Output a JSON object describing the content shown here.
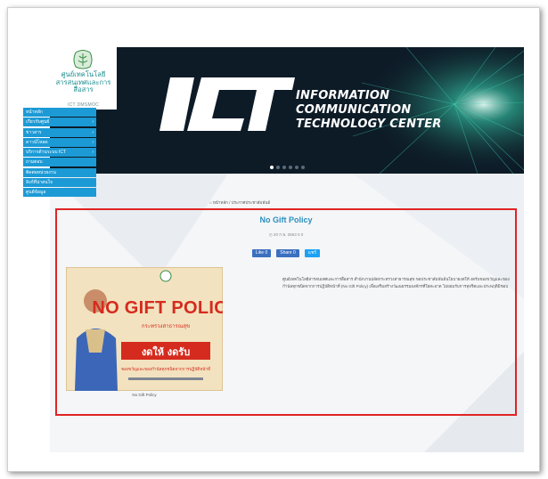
{
  "site": {
    "org_name_th": "ศูนย์เทคโนโลยีสารสนเทศและการสื่อสาร",
    "org_short": "ICT DMSMOC"
  },
  "banner": {
    "logo_text": "ICT",
    "line1": "INFORMATION",
    "line2": "COMMUNICATION",
    "line3": "TECHNOLOGY CENTER",
    "slides_total": 6,
    "slide_active": 1
  },
  "menu": {
    "items": [
      {
        "label": "หน้าหลัก",
        "has_caret": false
      },
      {
        "label": "เกี่ยวกับศูนย์",
        "has_caret": true
      },
      {
        "label": "ข่าวสาร",
        "has_caret": true
      },
      {
        "label": "ดาวน์โหลด",
        "has_caret": true
      },
      {
        "label": "บริการด้านระบบ ICT",
        "has_caret": true
      },
      {
        "label": "ถามตอบ",
        "has_caret": false
      },
      {
        "label": "ติดต่อหน่วยงาน",
        "has_caret": false
      },
      {
        "label": "ลิงก์ที่น่าสนใจ",
        "has_caret": false
      },
      {
        "label": "ศูนย์ข้อมูล",
        "has_caret": false
      }
    ]
  },
  "breadcrumb": {
    "text": "หน้าหลัก / ประกาศประชาสัมพันธ์"
  },
  "post": {
    "title": "No Gift Policy",
    "meta": "20 ก.พ. 2563   0   0",
    "share": {
      "like": "Like 0",
      "share": "Share 0",
      "tweet": "แชร์"
    },
    "image_caption": "No Gift Policy",
    "body": "ศูนย์เทคโนโลยีสารสนเทศและการสื่อสาร สำนักงานปลัดกระทรวงสาธารณสุข ขอประชาสัมพันธ์นโยบายงดให้ งดรับของขวัญและของกำนัลทุกชนิดจากการปฏิบัติหน้าที่ (No Gift Policy) เพื่อเสริมสร้างวัฒนธรรมองค์กรที่ใสสะอาด ไม่ยอมรับการทุจริตและประพฤติมิชอบ"
  },
  "poster": {
    "headline": "NO GIFT POLICY",
    "ministry": "กระทรวงสาธารณสุข",
    "slogan": "งดให้ งดรับ",
    "subtitle": "ของขวัญและของกำนัลทุกชนิดจากการปฏิบัติหน้าที่",
    "colors": {
      "background": "#f3e2bf",
      "red": "#d52b1e",
      "navy": "#1f3a6e"
    }
  },
  "colors": {
    "menu_blue": "#1c9ad6",
    "title_blue": "#2b8fbf",
    "highlight_red": "#e02424",
    "banner_dark": "#0d1b27"
  }
}
